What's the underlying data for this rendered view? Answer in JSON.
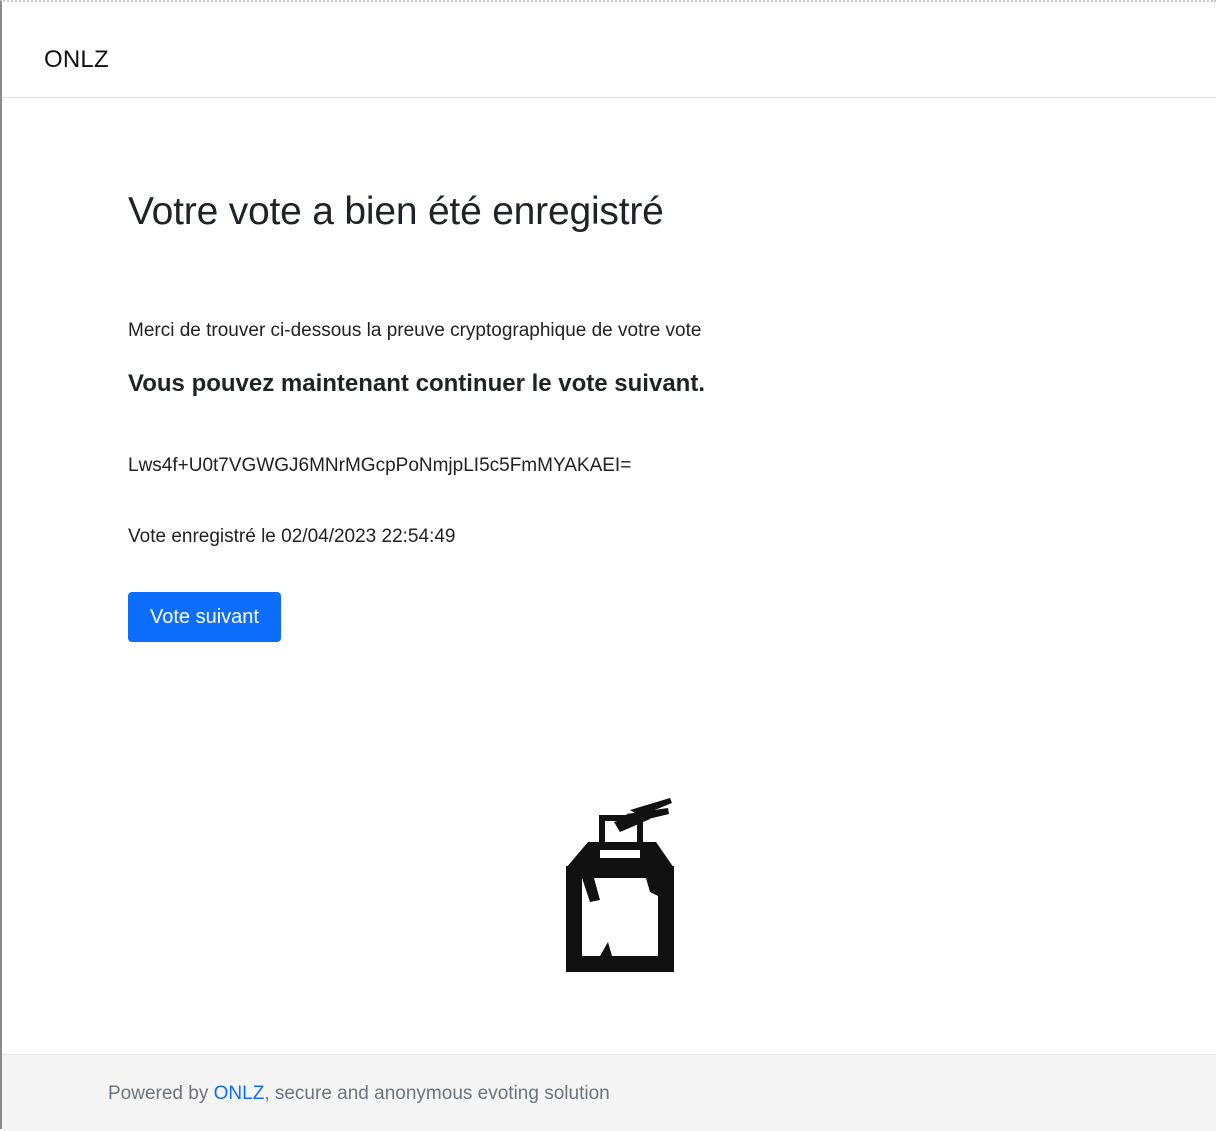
{
  "navbar": {
    "brand": "ONLZ"
  },
  "main": {
    "title": "Votre vote a bien été enregistré",
    "intro": "Merci de trouver ci-dessous la preuve cryptographique de votre vote",
    "next_message": "Vous pouvez maintenant continuer le vote suivant.",
    "proof_hash": "Lws4f+U0t7VGWGJ6MNrMGcpPoNmjpLI5c5FmMYAKAEI=",
    "timestamp_label": "Vote enregistré le 02/04/2023 22:54:49",
    "next_button_label": "Vote suivant",
    "illustration_icon": "ballot-box-icon"
  },
  "footer": {
    "prefix": "Powered by ",
    "link_label": "ONLZ",
    "suffix": ", secure and anonymous evoting solution"
  },
  "colors": {
    "primary": "#0d6efd",
    "footer_bg": "#f5f5f5",
    "footer_text": "#6c757d"
  }
}
